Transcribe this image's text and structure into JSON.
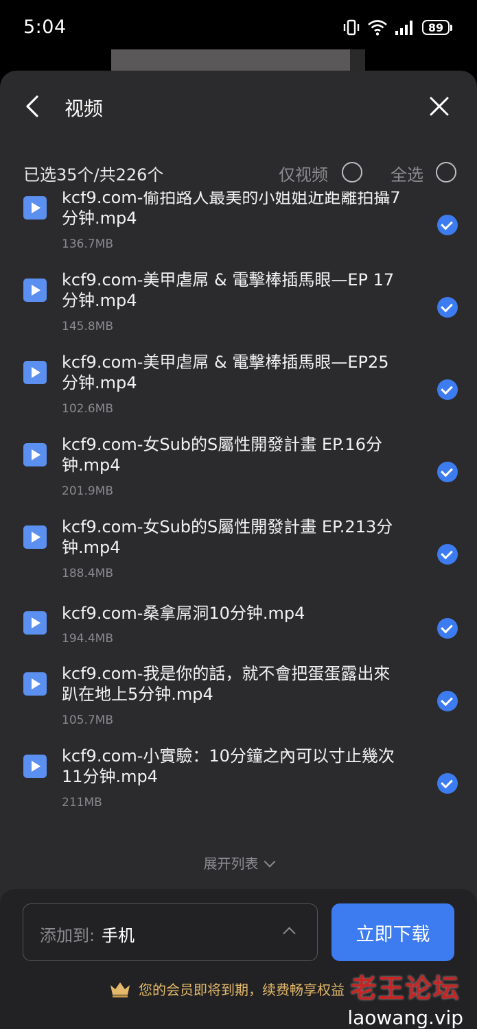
{
  "status_bar": {
    "time": "5:04",
    "battery": "89"
  },
  "header": {
    "title": "视频"
  },
  "selection": {
    "count_text": "已选35个/共226个",
    "video_only_label": "仅视频",
    "select_all_label": "全选"
  },
  "files": [
    {
      "name": "kcf9.com-偷拍路人最美的小姐姐近距離拍攝7分钟.mp4",
      "size": "136.7MB",
      "checked": true
    },
    {
      "name": "kcf9.com-美甲虐屌 & 電擊棒插馬眼—EP 17分钟.mp4",
      "size": "145.8MB",
      "checked": true
    },
    {
      "name": "kcf9.com-美甲虐屌 & 電擊棒插馬眼—EP25分钟.mp4",
      "size": "102.6MB",
      "checked": true
    },
    {
      "name": "kcf9.com-女Sub的S屬性開發計畫 EP.16分钟.mp4",
      "size": "201.9MB",
      "checked": true
    },
    {
      "name": "kcf9.com-女Sub的S屬性開發計畫 EP.213分钟.mp4",
      "size": "188.4MB",
      "checked": true
    },
    {
      "name": "kcf9.com-桑拿屌洞10分钟.mp4",
      "size": "194.4MB",
      "checked": true
    },
    {
      "name": "kcf9.com-我是你的話，就不會把蛋蛋露出來趴在地上5分钟.mp4",
      "size": "105.7MB",
      "checked": true
    },
    {
      "name": "kcf9.com-小實驗：10分鐘之內可以寸止幾次11分钟.mp4",
      "size": "211MB",
      "checked": true
    }
  ],
  "expand_label": "展开列表",
  "bottom": {
    "destination_label": "添加到:",
    "destination_value": "手机",
    "download_label": "立即下载",
    "vip_notice": "您的会员即将到期，续费畅享权益"
  },
  "watermark": {
    "title": "老王论坛",
    "url": "laowang.vip"
  },
  "colors": {
    "accent": "#3d7cf0",
    "sheet_bg": "#2b2b2d",
    "vip_gold": "#e3b86a"
  }
}
